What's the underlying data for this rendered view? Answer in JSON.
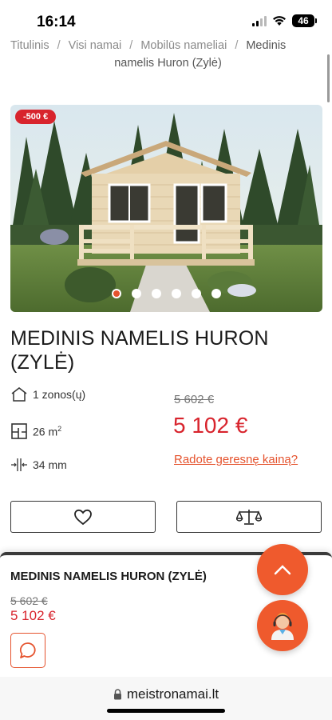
{
  "status": {
    "time": "16:14",
    "battery": "46"
  },
  "breadcrumb": {
    "items": [
      "Titulinis",
      "Visi namai",
      "Mobilūs nameliai",
      "Medinis namelis Huron (Zylė)"
    ],
    "line1_last": "Medinis",
    "line2": "namelis Huron (Zylė)"
  },
  "gallery": {
    "badge": "-500 €",
    "dot_count": 6,
    "active_index": 0
  },
  "product": {
    "title": "MEDINIS NAMELIS HURON (ZYLĖ)",
    "specs": {
      "zones": "1 zonos(ų)",
      "area_value": "26 m",
      "area_unit_sup": "2",
      "thickness": "34 mm"
    },
    "old_price": "5 602 €",
    "new_price": "5 102 €",
    "better_price_link": "Radote geresnę kainą?"
  },
  "actions": {
    "favorite_icon": "heart-icon",
    "compare_icon": "scale-icon"
  },
  "sticky": {
    "title": "MEDINIS NAMELIS HURON (ZYLĖ)",
    "old_price": "5 602 €",
    "new_price": "5 102 €"
  },
  "browser": {
    "url": "meistronamai.lt"
  },
  "colors": {
    "accent": "#ef5a2d",
    "price_red": "#d8242d",
    "badge_red": "#d8242d"
  }
}
